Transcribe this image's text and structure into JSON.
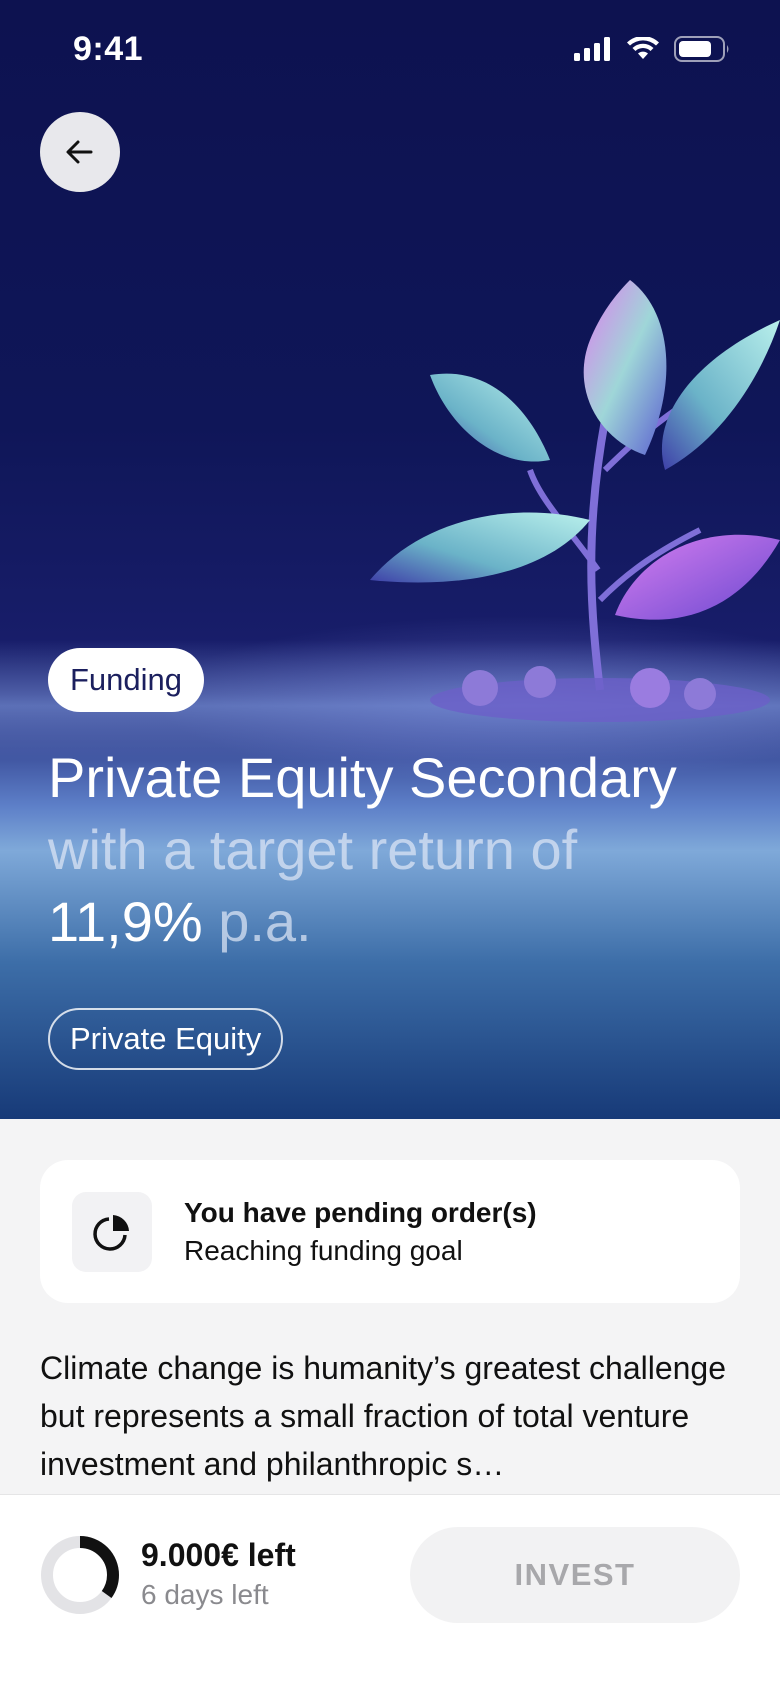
{
  "status_bar": {
    "time": "9:41"
  },
  "hero": {
    "status_badge": "Funding",
    "title": "Private Equity Secondary",
    "subtitle_prefix": "with a target return of",
    "return_value": "11,9%",
    "return_unit": "p.a.",
    "category_tag": "Private Equity"
  },
  "notice": {
    "title": "You have pending order(s)",
    "subtitle": "Reaching funding goal"
  },
  "description": "Climate change is humanity’s greatest challenge but represents a small fraction of total venture investment and philanthropic s…",
  "footer": {
    "amount_left": "9.000€ left",
    "days_left": "6 days left",
    "funding_progress": 0.35,
    "invest_label": "INVEST"
  },
  "colors": {
    "hero_top": "#0d1250",
    "hero_bottom": "#173a78",
    "badge_text": "#1b1f5e",
    "page_bg": "#f4f4f5"
  }
}
